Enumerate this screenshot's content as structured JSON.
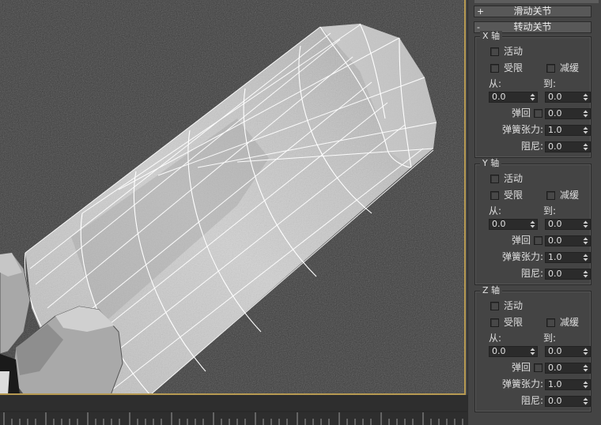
{
  "panel": {
    "rollouts": [
      {
        "sign": "+",
        "label": "滑动关节"
      },
      {
        "sign": "-",
        "label": "转动关节"
      }
    ],
    "axes": [
      {
        "title": "X 轴",
        "active_label": "活动",
        "limited_label": "受限",
        "ease_label": "减缓",
        "from_label": "从:",
        "to_label": "到:",
        "from_value": "0.0",
        "to_value": "0.0",
        "bounce_label": "弹回",
        "bounce_value": "0.0",
        "spring_label": "弹簧张力:",
        "spring_value": "1.0",
        "damping_label": "阻尼:",
        "damping_value": "0.0"
      },
      {
        "title": "Y 轴",
        "active_label": "活动",
        "limited_label": "受限",
        "ease_label": "减缓",
        "from_label": "从:",
        "to_label": "到:",
        "from_value": "0.0",
        "to_value": "0.0",
        "bounce_label": "弹回",
        "bounce_value": "0.0",
        "spring_label": "弹簧张力:",
        "spring_value": "1.0",
        "damping_label": "阻尼:",
        "damping_value": "0.0"
      },
      {
        "title": "Z 轴",
        "active_label": "活动",
        "limited_label": "受限",
        "ease_label": "减缓",
        "from_label": "从:",
        "to_label": "到:",
        "from_value": "0.0",
        "to_value": "0.0",
        "bounce_label": "弹回",
        "bounce_value": "0.0",
        "spring_label": "弹簧张力:",
        "spring_value": "1.0",
        "damping_label": "阻尼:",
        "damping_value": "0.0"
      }
    ]
  },
  "colors": {
    "viewport_bg": "#3c3c3c",
    "viewport_border": "#b79a52",
    "panel_bg": "#444444",
    "wireframe": "#ffffff"
  }
}
